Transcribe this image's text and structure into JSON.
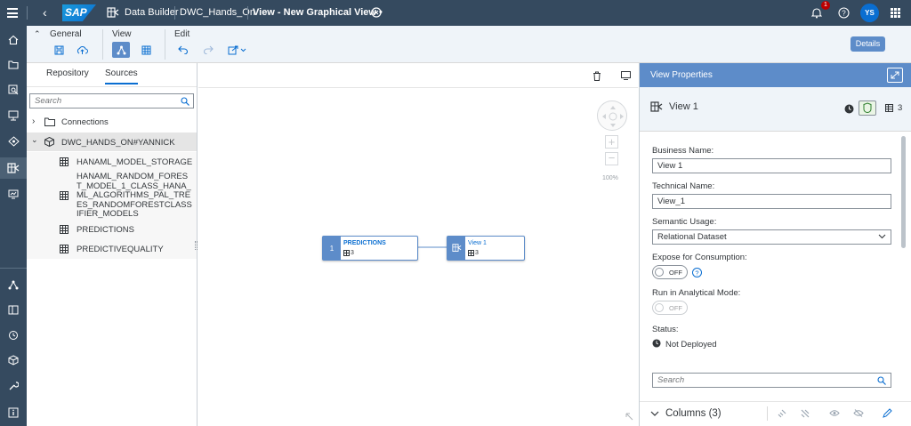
{
  "shell": {
    "logo": "SAP",
    "app_name": "Data Builder",
    "crumb_space": "DWC_Hands_On",
    "crumb_view": "View - New Graphical View",
    "modified_marker": "•",
    "notification_count": "1",
    "avatar_initials": "YS"
  },
  "toolbar": {
    "general_label": "General",
    "view_label": "View",
    "edit_label": "Edit",
    "details_label": "Details"
  },
  "left_panel": {
    "tabs": [
      "Repository",
      "Sources"
    ],
    "active_tab": "Sources",
    "search_placeholder": "Search",
    "tree": {
      "connections_label": "Connections",
      "space_label": "DWC_HANDS_ON#YANNICK",
      "items": [
        "HANAML_MODEL_STORAGE",
        "HANAML_RANDOM_FOREST_MODEL_1_CLASS_HANA_ML_ALGORITHMS_PAL_TREES_RANDOMFORESTCLASSIFIER_MODELS",
        "PREDICTIONS",
        "PREDICTIVEQUALITY"
      ]
    }
  },
  "canvas": {
    "zoom": "100%",
    "nodes": [
      {
        "badge": "1",
        "name": "PREDICTIONS",
        "columns": "3"
      },
      {
        "name": "View 1",
        "columns": "3"
      }
    ]
  },
  "right_panel": {
    "header_title": "View Properties",
    "view_name": "View 1",
    "column_count": "3",
    "business_name_label": "Business Name:",
    "business_name_value": "View 1",
    "technical_name_label": "Technical Name:",
    "technical_name_value": "View_1",
    "semantic_usage_label": "Semantic Usage:",
    "semantic_usage_value": "Relational Dataset",
    "expose_label": "Expose for Consumption:",
    "expose_toggle": "OFF",
    "analytical_label": "Run in Analytical Mode:",
    "analytical_toggle": "OFF",
    "status_label": "Status:",
    "status_value": "Not Deployed",
    "search_placeholder": "Search",
    "columns_title": "Columns (3)"
  },
  "colors": {
    "shell": "#354a5f",
    "accent": "#5d8cc9",
    "brand_blue": "#0a6ed1"
  }
}
